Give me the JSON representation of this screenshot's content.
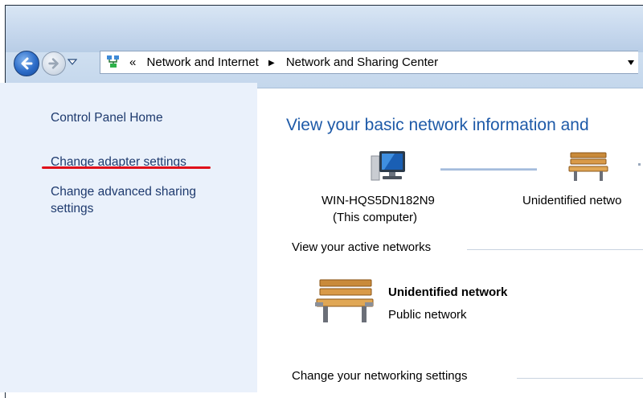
{
  "nav": {
    "back_icon": "back-arrow-icon",
    "forward_icon": "forward-arrow-icon",
    "recent_icon": "chevron-down-icon"
  },
  "address": {
    "prefix": "«",
    "crumb1": "Network and Internet",
    "crumb2": "Network and Sharing Center",
    "separator": "▶",
    "dropdown_icon": "chevron-down-icon"
  },
  "sidebar": {
    "home": "Control Panel Home",
    "adapter": "Change adapter settings",
    "advanced_line1": "Change advanced sharing",
    "advanced_line2": "settings",
    "highlight_color": "#e0101a"
  },
  "main": {
    "title": "View your basic network information and",
    "computer_name": "WIN-HQS5DN182N9",
    "computer_sub": "(This computer)",
    "network_map_label": "Unidentified netwo",
    "active_networks_heading": "View your active networks",
    "active_network_name": "Unidentified network",
    "active_network_type": "Public network",
    "change_settings_heading": "Change your networking settings"
  },
  "colors": {
    "title": "#1e5aa8",
    "link": "#1e3a6e",
    "sidebar_bg": "#eaf1fb"
  }
}
